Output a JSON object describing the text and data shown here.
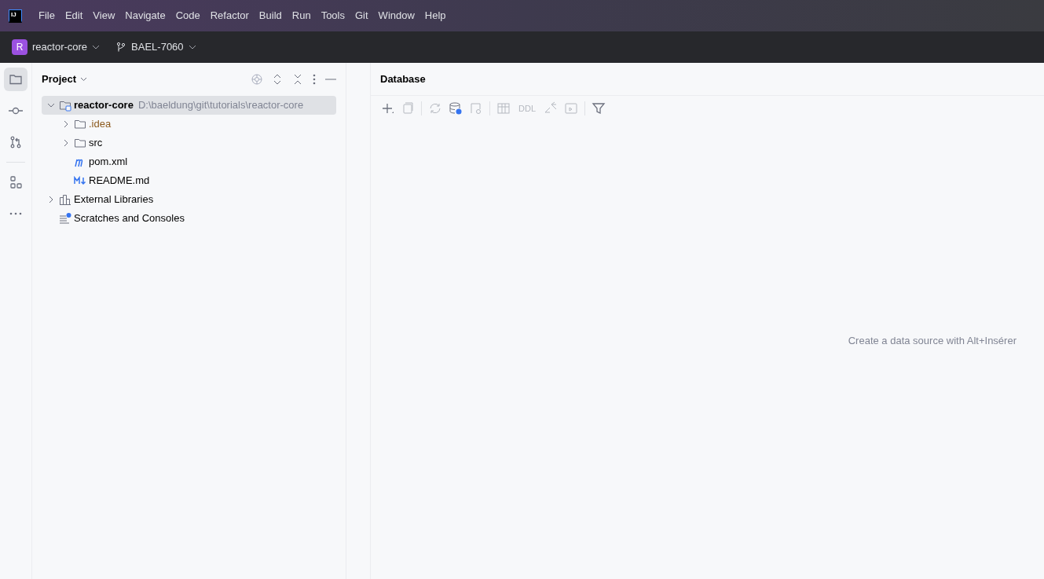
{
  "app_logo": "IJ",
  "menu": [
    "File",
    "Edit",
    "View",
    "Navigate",
    "Code",
    "Refactor",
    "Build",
    "Run",
    "Tools",
    "Git",
    "Window",
    "Help"
  ],
  "toolbar": {
    "project_badge": "R",
    "project": "reactor-core",
    "branch": "BAEL-7060"
  },
  "stripe": [
    {
      "kind": "folder",
      "selected": true
    },
    {
      "kind": "commit",
      "selected": false
    },
    {
      "kind": "pull",
      "selected": false
    },
    {
      "kind": "structure",
      "selected": false
    },
    {
      "kind": "more",
      "selected": false
    }
  ],
  "project_panel": {
    "title": "Project",
    "tree": [
      {
        "kind": "module",
        "label": "reactor-core",
        "path": "D:\\baeldung\\git\\tutorials\\reactor-core",
        "expanded": true,
        "selected": true,
        "vcs_ignored": false,
        "children": [
          {
            "kind": "folder",
            "label": ".idea",
            "expanded": false,
            "selected": false,
            "vcs_ignored": true
          },
          {
            "kind": "folder",
            "label": "src",
            "expanded": false,
            "selected": false,
            "vcs_ignored": false
          },
          {
            "kind": "maven",
            "label": "pom.xml",
            "selected": false,
            "vcs_ignored": false
          },
          {
            "kind": "markdown",
            "label": "README.md",
            "selected": false,
            "vcs_ignored": false
          }
        ]
      },
      {
        "kind": "library",
        "label": "External Libraries",
        "expanded": false,
        "selected": false,
        "vcs_ignored": false
      },
      {
        "kind": "scratches",
        "label": "Scratches and Consoles",
        "selected": false,
        "vcs_ignored": false
      }
    ]
  },
  "database_panel": {
    "title": "Database",
    "actions": [
      {
        "kind": "add",
        "disabled": false
      },
      {
        "kind": "copy",
        "disabled": true
      },
      {
        "kind": "sep"
      },
      {
        "kind": "refresh",
        "disabled": true
      },
      {
        "kind": "db-settings",
        "disabled": false
      },
      {
        "kind": "disconnect",
        "disabled": true
      },
      {
        "kind": "sep"
      },
      {
        "kind": "table",
        "disabled": true
      },
      {
        "kind": "text",
        "label": "DDL",
        "disabled": true
      },
      {
        "kind": "compare",
        "disabled": true
      },
      {
        "kind": "console",
        "disabled": true
      },
      {
        "kind": "sep"
      },
      {
        "kind": "filter",
        "disabled": false
      }
    ],
    "empty_hint": "Create a data source with Alt+Insérer"
  }
}
